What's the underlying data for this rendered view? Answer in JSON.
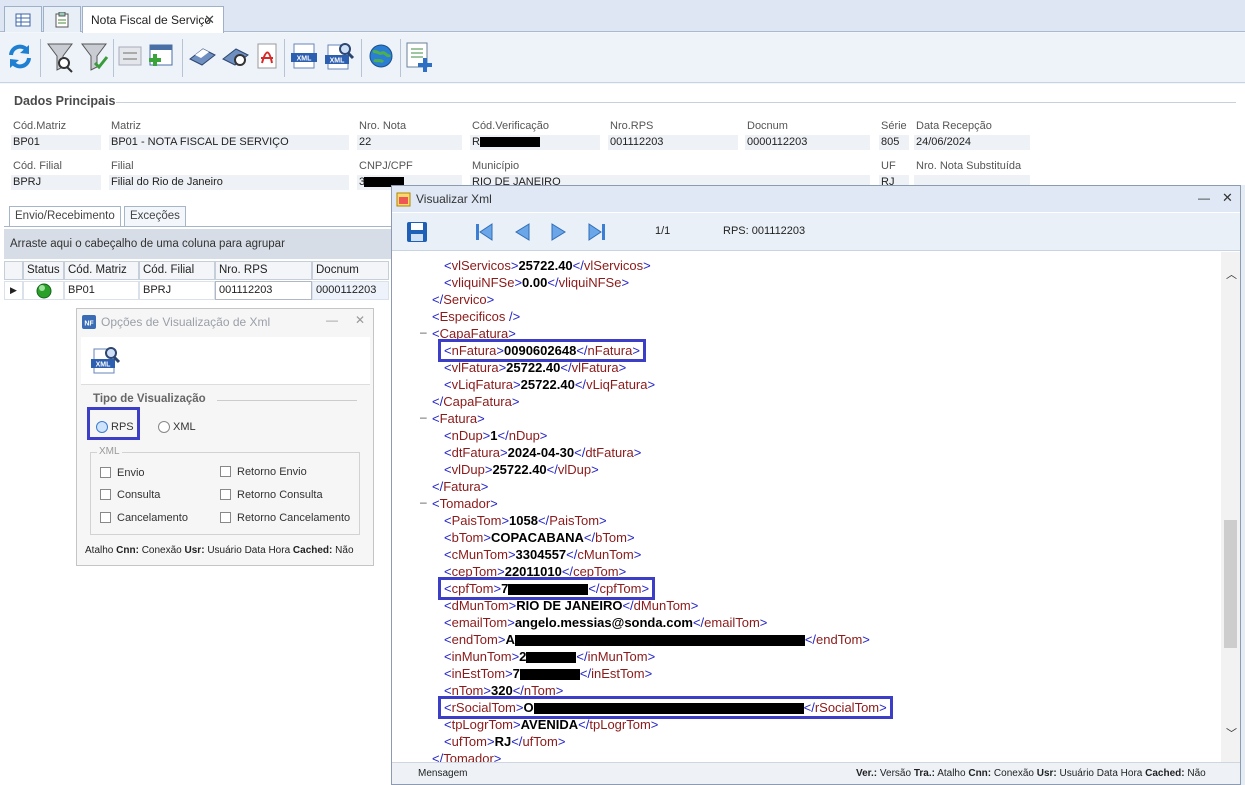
{
  "tabs": {
    "active_label": "Nota Fiscal de Serviço"
  },
  "section_title": "Dados Principais",
  "fields": {
    "cod_matriz": {
      "label": "Cód.Matriz",
      "value": "BP01"
    },
    "matriz": {
      "label": "Matriz",
      "value": "BP01 - NOTA FISCAL DE SERVIÇO"
    },
    "nro_nota": {
      "label": "Nro. Nota",
      "value": "22"
    },
    "cod_verificacao": {
      "label": "Cód.Verificação",
      "value": "R"
    },
    "nro_rps": {
      "label": "Nro.RPS",
      "value": "001112203"
    },
    "docnum": {
      "label": "Docnum",
      "value": "0000112203"
    },
    "serie": {
      "label": "Série",
      "value": "805"
    },
    "data_recepcao": {
      "label": "Data Recepção",
      "value": "24/06/2024"
    },
    "cod_filial": {
      "label": "Cód. Filial",
      "value": "BPRJ"
    },
    "filial": {
      "label": "Filial",
      "value": "Filial do Rio de Janeiro"
    },
    "cnpj": {
      "label": "CNPJ/CPF",
      "value": "3"
    },
    "municipio": {
      "label": "Município",
      "value": "RIO DE JANEIRO"
    },
    "uf": {
      "label": "UF",
      "value": "RJ"
    },
    "nro_nota_subst": {
      "label": "Nro. Nota Substituída",
      "value": ""
    }
  },
  "subtabs": [
    "Envio/Recebimento",
    "Exceções"
  ],
  "grid": {
    "group_hint": "Arraste aqui o cabeçalho de uma coluna para agrupar",
    "headers": [
      "Status",
      "Cód. Matriz",
      "Cód. Filial",
      "Nro. RPS",
      "Docnum"
    ],
    "row": {
      "cod_matriz": "BP01",
      "cod_filial": "BPRJ",
      "nro_rps": "001112203",
      "docnum": "0000112203"
    }
  },
  "options_dialog": {
    "title": "Opções de Visualização de Xml",
    "group": "Tipo de Visualização",
    "radio_rps": "RPS",
    "radio_xml": "XML",
    "xml_group": "XML",
    "checks": [
      "Envio",
      "Retorno Envio",
      "Consulta",
      "Retorno Consulta",
      "Cancelamento",
      "Retorno Cancelamento"
    ],
    "footer": {
      "k1": "Atalho",
      "k2": "Cnn:",
      "v2": "Conexão",
      "k3": "Usr:",
      "v3": "Usuário",
      "k4": "Data Hora",
      "k5": "Cached:",
      "v5": "Não"
    }
  },
  "xml_viewer": {
    "title": "Visualizar Xml",
    "page": "1/1",
    "rps": "RPS: 001112203",
    "status": {
      "left": "Mensagem",
      "ver": "Ver.:",
      "ver_v": "Versão",
      "tra": "Tra.:",
      "tra_v": "Atalho",
      "cnn": "Cnn:",
      "cnn_v": "Conexão",
      "usr": "Usr:",
      "usr_v": "Usuário",
      "dh": "Data Hora",
      "cached": "Cached:",
      "cached_v": "Não"
    },
    "lines": [
      {
        "indent": 2,
        "minus": false,
        "tag": "vlServicos",
        "value": "25722.40"
      },
      {
        "indent": 2,
        "minus": false,
        "tag": "vliquiNFSe",
        "value": "0.00"
      },
      {
        "indent": 1,
        "minus": false,
        "close": "Servico"
      },
      {
        "indent": 1,
        "minus": false,
        "selfclose": "Especificos"
      },
      {
        "indent": 1,
        "minus": true,
        "open": "CapaFatura"
      },
      {
        "indent": 2,
        "minus": false,
        "tag": "nFatura",
        "value": "0090602648"
      },
      {
        "indent": 2,
        "minus": false,
        "tag": "vlFatura",
        "value": "25722.40"
      },
      {
        "indent": 2,
        "minus": false,
        "tag": "vLiqFatura",
        "value": "25722.40"
      },
      {
        "indent": 1,
        "minus": false,
        "close": "CapaFatura"
      },
      {
        "indent": 1,
        "minus": true,
        "open": "Fatura"
      },
      {
        "indent": 2,
        "minus": false,
        "tag": "nDup",
        "value": "1"
      },
      {
        "indent": 2,
        "minus": false,
        "tag": "dtFatura",
        "value": "2024-04-30"
      },
      {
        "indent": 2,
        "minus": false,
        "tag": "vlDup",
        "value": "25722.40"
      },
      {
        "indent": 1,
        "minus": false,
        "close": "Fatura"
      },
      {
        "indent": 1,
        "minus": true,
        "open": "Tomador"
      },
      {
        "indent": 2,
        "minus": false,
        "tag": "PaisTom",
        "value": "1058"
      },
      {
        "indent": 2,
        "minus": false,
        "tag": "bTom",
        "value": "COPACABANA"
      },
      {
        "indent": 2,
        "minus": false,
        "tag": "cMunTom",
        "value": "3304557"
      },
      {
        "indent": 2,
        "minus": false,
        "tag": "cepTom",
        "value": "22011010"
      },
      {
        "indent": 2,
        "minus": false,
        "tag": "cpfTom",
        "value": "7",
        "redacted": true
      },
      {
        "indent": 2,
        "minus": false,
        "tag": "dMunTom",
        "value": "RIO DE JANEIRO"
      },
      {
        "indent": 2,
        "minus": false,
        "tag": "emailTom",
        "value": "angelo.messias@sonda.com"
      },
      {
        "indent": 2,
        "minus": false,
        "tag": "endTom",
        "value": "A",
        "redacted": true
      },
      {
        "indent": 2,
        "minus": false,
        "tag": "inMunTom",
        "value": "2",
        "redacted": true
      },
      {
        "indent": 2,
        "minus": false,
        "tag": "inEstTom",
        "value": "7",
        "redacted": true
      },
      {
        "indent": 2,
        "minus": false,
        "tag": "nTom",
        "value": "320"
      },
      {
        "indent": 2,
        "minus": false,
        "tag": "rSocialTom",
        "value": "O",
        "redacted": true
      },
      {
        "indent": 2,
        "minus": false,
        "tag": "tpLogrTom",
        "value": "AVENIDA"
      },
      {
        "indent": 2,
        "minus": false,
        "tag": "ufTom",
        "value": "RJ"
      },
      {
        "indent": 1,
        "minus": false,
        "close": "Tomador"
      }
    ]
  },
  "colors": {
    "tag": "#8b1a1a",
    "bracket": "#2323c8",
    "highlight": "#3c3ec8"
  }
}
